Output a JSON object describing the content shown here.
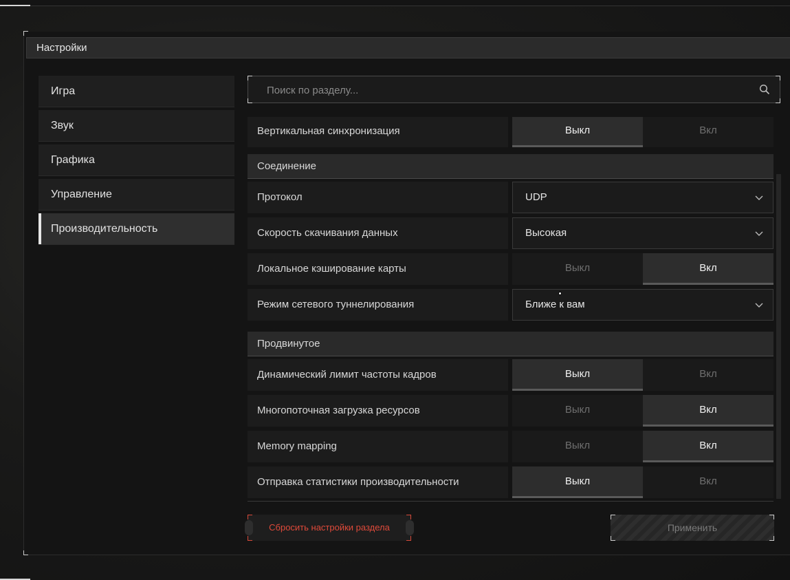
{
  "window": {
    "title": "Настройки"
  },
  "sidebar": {
    "items": [
      {
        "label": "Игра",
        "active": false
      },
      {
        "label": "Звук",
        "active": false
      },
      {
        "label": "Графика",
        "active": false
      },
      {
        "label": "Управление",
        "active": false
      },
      {
        "label": "Производительность",
        "active": true
      }
    ]
  },
  "search": {
    "placeholder": "Поиск по разделу...",
    "value": "",
    "icon": "search-icon"
  },
  "settings": {
    "vsync": {
      "label": "Вертикальная синхронизация",
      "off": "Выкл",
      "on": "Вкл",
      "selected": "off"
    },
    "connection_section": "Соединение",
    "protocol": {
      "label": "Протокол",
      "value": "UDP"
    },
    "download_speed": {
      "label": "Скорость скачивания данных",
      "value": "Высокая"
    },
    "map_cache": {
      "label": "Локальное кэширование карты",
      "off": "Выкл",
      "on": "Вкл",
      "selected": "on"
    },
    "tunneling": {
      "label": "Режим сетевого туннелирования",
      "value": "Ближе к вам"
    },
    "advanced_section": "Продвинутое",
    "dynamic_fps": {
      "label": "Динамический лимит частоты кадров",
      "off": "Выкл",
      "on": "Вкл",
      "selected": "off"
    },
    "multithread_load": {
      "label": "Многопоточная загрузка ресурсов",
      "off": "Выкл",
      "on": "Вкл",
      "selected": "on"
    },
    "memory_mapping": {
      "label": "Memory mapping",
      "off": "Выкл",
      "on": "Вкл",
      "selected": "on"
    },
    "perf_stats": {
      "label": "Отправка статистики производительности",
      "off": "Выкл",
      "on": "Вкл",
      "selected": "off"
    }
  },
  "footer": {
    "reset_label": "Сбросить настройки раздела",
    "apply_label": "Применить"
  },
  "colors": {
    "danger": "#e04a3a",
    "active_text": "#f2f2f2",
    "muted_text": "#6f6f6f"
  }
}
